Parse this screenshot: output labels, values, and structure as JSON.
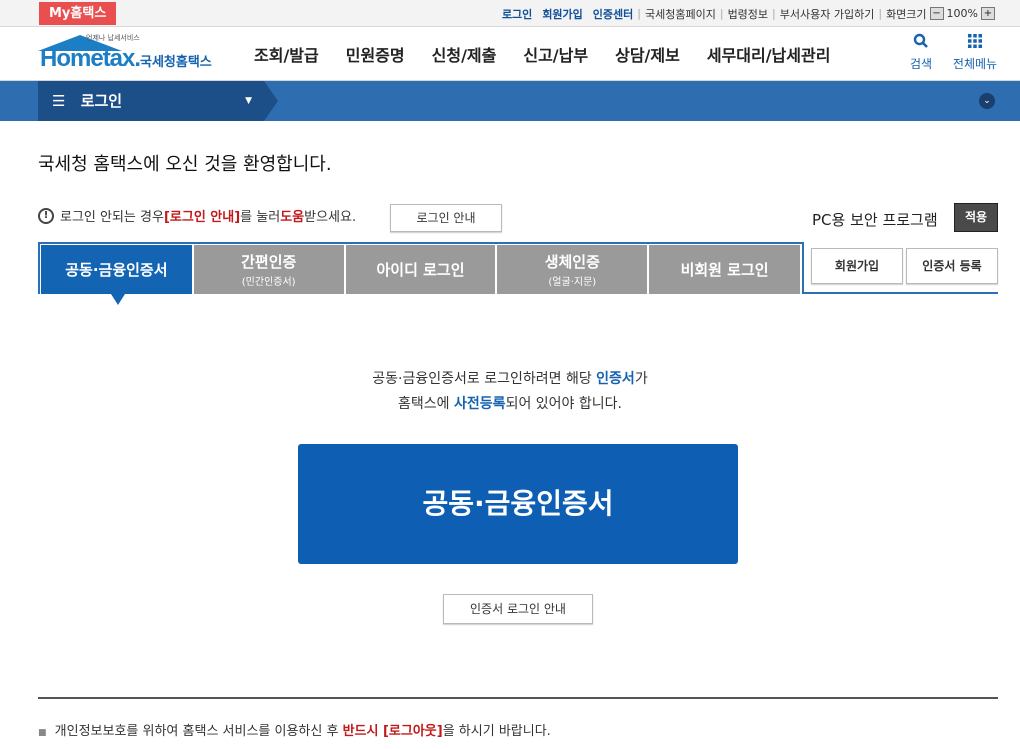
{
  "topbar": {
    "my_tab": "My홈택스",
    "links_bold": [
      "로그인",
      "회원가입",
      "인증센터"
    ],
    "links_plain": [
      "국세청홈페이지",
      "법령정보",
      "부서사용자 가입하기",
      "화면크기"
    ],
    "zoom_minus": "−",
    "zoom_value": "100%",
    "zoom_plus": "+"
  },
  "header": {
    "logo_small": "언제나 납세서비스",
    "logo_word_a": "Hom",
    "logo_word_b": "etax.",
    "logo_kr": "국세청홈택스",
    "gnb": [
      "조회/발급",
      "민원증명",
      "신청/제출",
      "신고/납부",
      "상담/제보",
      "세무대리/납세관리"
    ],
    "search_label": "검색",
    "allmenu_label": "전체메뉴"
  },
  "lnb": {
    "current": "로그인"
  },
  "main": {
    "welcome": "국세청 홈택스에 오신 것을 환영합니다.",
    "notice_a": "로그인 안되는 경우 ",
    "notice_red1": "[로그인 안내]",
    "notice_b": "를 눌러 ",
    "notice_red2": "도움",
    "notice_c": "받으세요.",
    "guide_button": "로그인 안내",
    "pc_label": "PC용 보안 프로그램",
    "apply_button": "적용",
    "tabs": [
      {
        "label": "공동·금융인증서",
        "sub": ""
      },
      {
        "label": "간편인증",
        "sub": "(민간인증서)"
      },
      {
        "label": "아이디 로그인",
        "sub": ""
      },
      {
        "label": "생체인증",
        "sub": "(얼굴·지문)"
      },
      {
        "label": "비회원 로그인",
        "sub": ""
      }
    ],
    "join_button": "회원가입",
    "cert_register_button": "인증서 등록",
    "desc1_a": "공동·금융인증서로 로그인하려면 해당 ",
    "desc1_blue": "인증서",
    "desc1_b": "가",
    "desc2_a": "홈택스에 ",
    "desc2_blue": "사전등록",
    "desc2_b": "되어 있어야 합니다.",
    "big_button": "공동·금융인증서",
    "cert_guide_button": "인증서 로그인 안내"
  },
  "footer": {
    "note_a": "개인정보보호를 위하여 홈택스 서비스를 이용하신 후 ",
    "note_red": "반드시 [로그아웃]",
    "note_b": "을 하시기 바랍니다."
  }
}
